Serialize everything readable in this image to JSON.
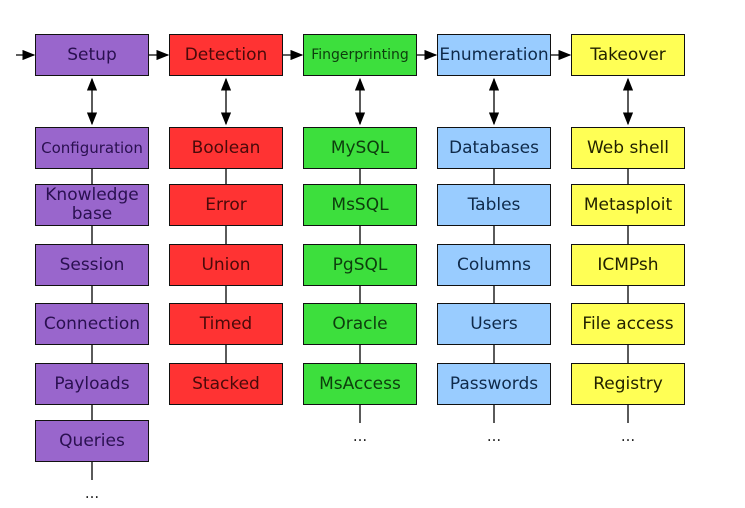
{
  "columns": [
    {
      "header": "Setup",
      "color": "#9966cc",
      "items": [
        "Configuration",
        "Knowledge base",
        "Session",
        "Connection",
        "Payloads",
        "Queries"
      ],
      "more": "..."
    },
    {
      "header": "Detection",
      "color": "#ff3333",
      "items": [
        "Boolean",
        "Error",
        "Union",
        "Timed",
        "Stacked"
      ],
      "more": ""
    },
    {
      "header": "Fingerprinting",
      "color": "#3ddf3d",
      "items": [
        "MySQL",
        "MsSQL",
        "PgSQL",
        "Oracle",
        "MsAccess"
      ],
      "more": "..."
    },
    {
      "header": "Enumeration",
      "color": "#99ccff",
      "items": [
        "Databases",
        "Tables",
        "Columns",
        "Users",
        "Passwords"
      ],
      "more": "..."
    },
    {
      "header": "Takeover",
      "color": "#ffff55",
      "items": [
        "Web shell",
        "Metasploit",
        "ICMPsh",
        "File access",
        "Registry"
      ],
      "more": "..."
    }
  ]
}
